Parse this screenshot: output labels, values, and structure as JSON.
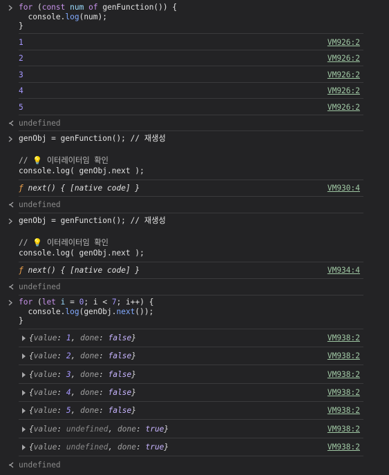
{
  "block1": {
    "code_lines": [
      "for (const num of genFunction()) {",
      "  console.log(num);",
      "}"
    ],
    "logs": [
      {
        "value": "1",
        "source": "VM926:2"
      },
      {
        "value": "2",
        "source": "VM926:2"
      },
      {
        "value": "3",
        "source": "VM926:2"
      },
      {
        "value": "4",
        "source": "VM926:2"
      },
      {
        "value": "5",
        "source": "VM926:2"
      }
    ],
    "result": "undefined"
  },
  "block2": {
    "line1": "genObj = genFunction(); // 재생성",
    "comment": "// 💡 이터레이터임 확인",
    "line3": "console.log( genObj.next );",
    "output_sym": "ƒ",
    "output_text": "next() { [native code] }",
    "source": "VM930:4",
    "result": "undefined"
  },
  "block3": {
    "line1": "genObj = genFunction(); // 재생성",
    "comment": "// 💡 이터레이터임 확인",
    "line3": "console.log( genObj.next );",
    "output_sym": "ƒ",
    "output_text": "next() { [native code] }",
    "source": "VM934:4",
    "result": "undefined"
  },
  "block4": {
    "code_lines": [
      "for (let i = 0; i < 7; i++) {",
      "  console.log(genObj.next());",
      "}"
    ],
    "logs": [
      {
        "value": "1",
        "done": "false",
        "source": "VM938:2"
      },
      {
        "value": "2",
        "done": "false",
        "source": "VM938:2"
      },
      {
        "value": "3",
        "done": "false",
        "source": "VM938:2"
      },
      {
        "value": "4",
        "done": "false",
        "source": "VM938:2"
      },
      {
        "value": "5",
        "done": "false",
        "source": "VM938:2"
      },
      {
        "value": "undefined",
        "done": "true",
        "source": "VM938:2"
      },
      {
        "value": "undefined",
        "done": "true",
        "source": "VM938:2"
      }
    ],
    "result": "undefined"
  },
  "labels": {
    "value_key": "value",
    "done_key": "done"
  },
  "icons": {
    "prompt": "chevron-right-icon",
    "result": "return-arrow-icon",
    "expand": "expand-triangle-icon"
  }
}
